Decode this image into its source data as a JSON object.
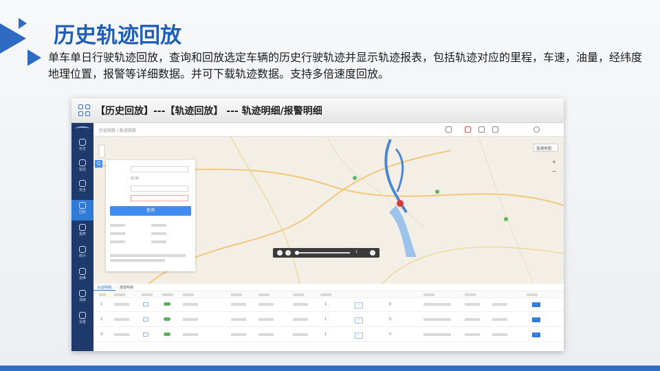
{
  "slide": {
    "title": "历史轨迹回放",
    "description": "单车单日行驶轨迹回放，查询和回放选定车辆的历史行驶轨迹并显示轨迹报表，包括轨迹对应的里程，车速，油量，经纬度地理位置，报警等详细数据。并可下载轨迹数据。支持多倍速度回放。",
    "accent_color": "#2d6bc4"
  },
  "screenshot": {
    "header": "【历史回放】---【轨迹回放】 --- 轨迹明细/报警明细",
    "nav": [
      {
        "label": "定位",
        "icon": "location-icon"
      },
      {
        "label": "监控",
        "icon": "monitor-icon"
      },
      {
        "label": "安全",
        "icon": "shield-icon"
      },
      {
        "label": "回放",
        "icon": "replay-icon",
        "active": true
      },
      {
        "label": "报表",
        "icon": "report-icon"
      },
      {
        "label": "统计",
        "icon": "chart-icon"
      },
      {
        "label": "运维",
        "icon": "maintenance-icon"
      },
      {
        "label": "调度",
        "icon": "dispatch-icon"
      },
      {
        "label": "设置",
        "icon": "settings-icon"
      }
    ],
    "breadcrumb": "历史回放 / 轨迹回放",
    "map_type": "普通地图",
    "query_button": "查询",
    "player_speed": "1",
    "table_tabs": [
      "轨迹明细",
      "报警明细"
    ],
    "rows": [
      {
        "index": "1",
        "count": "1",
        "status": "0"
      },
      {
        "index": "2",
        "count": "1",
        "status": "0"
      },
      {
        "index": "3",
        "count": "1",
        "status": "0"
      }
    ]
  }
}
